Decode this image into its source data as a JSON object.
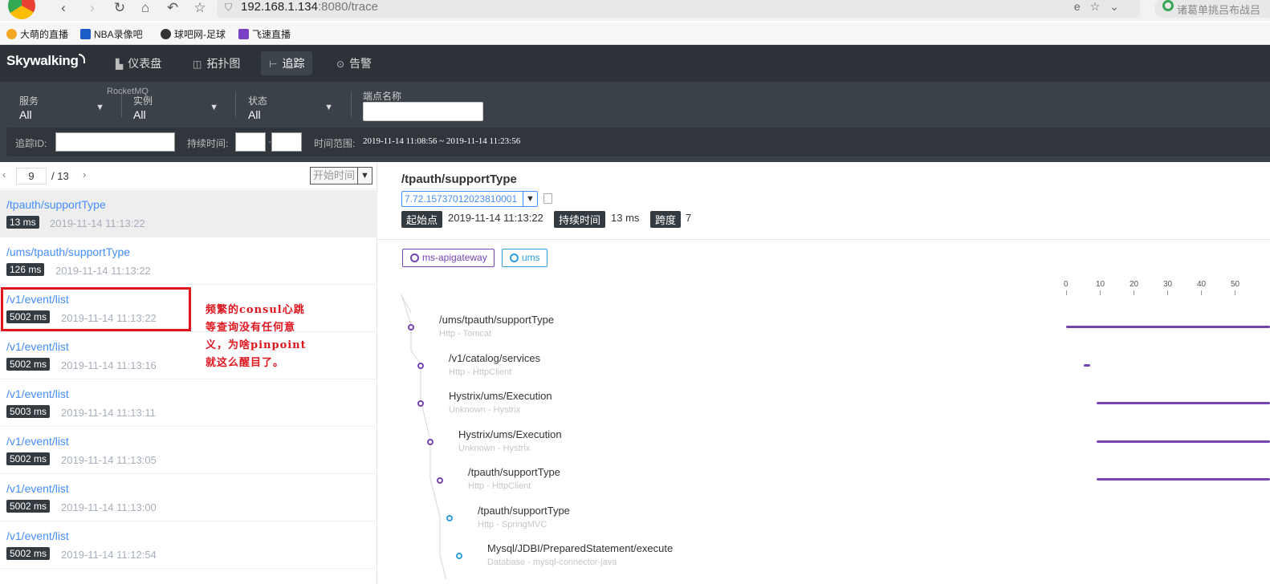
{
  "browser": {
    "url_host": "192.168.1.134",
    "url_rest": ":8080/trace",
    "search_text": "诸葛单挑吕布战吕",
    "bookmarks": [
      "大萌的直播",
      "NBA录像吧",
      "球吧网-足球",
      "飞速直播"
    ]
  },
  "app": {
    "logo": "Skywalking",
    "nav": [
      "仪表盘",
      "拓扑图",
      "追踪",
      "告警"
    ]
  },
  "filters": {
    "service_label": "服务",
    "service_value": "All",
    "instance_label": "实例",
    "instance_value": "All",
    "instance_overlay": "RocketMQ",
    "status_label": "状态",
    "status_value": "All",
    "endpoint_label": "端点名称",
    "trace_id_label": "追踪ID:",
    "duration_label": "持续时间:",
    "time_range_label": "时间范围:",
    "time_range_value": "2019-11-14 11:08:56 ~ 2019-11-14 11:23:56"
  },
  "list": {
    "page": "9",
    "total": "/ 13",
    "sort": "开始时间",
    "items": [
      {
        "endpoint": "/tpauth/supportType",
        "duration": "13 ms",
        "time": "2019-11-14 11:13:22"
      },
      {
        "endpoint": "/ums/tpauth/supportType",
        "duration": "126 ms",
        "time": "2019-11-14 11:13:22"
      },
      {
        "endpoint": "/v1/event/list",
        "duration": "5002 ms",
        "time": "2019-11-14 11:13:22"
      },
      {
        "endpoint": "/v1/event/list",
        "duration": "5002 ms",
        "time": "2019-11-14 11:13:16"
      },
      {
        "endpoint": "/v1/event/list",
        "duration": "5003 ms",
        "time": "2019-11-14 11:13:11"
      },
      {
        "endpoint": "/v1/event/list",
        "duration": "5002 ms",
        "time": "2019-11-14 11:13:05"
      },
      {
        "endpoint": "/v1/event/list",
        "duration": "5002 ms",
        "time": "2019-11-14 11:13:00"
      },
      {
        "endpoint": "/v1/event/list",
        "duration": "5002 ms",
        "time": "2019-11-14 11:12:54"
      }
    ],
    "annotation_lines": [
      "频繁的consul心跳",
      "等查询没有任何意",
      "义，为啥pinpoint",
      "就这么醒目了。"
    ]
  },
  "detail": {
    "title": "/tpauth/supportType",
    "trace_id": "7.72.15737012023810001",
    "start_label": "起始点",
    "start_value": "2019-11-14 11:13:22",
    "duration_label": "持续时间",
    "duration_value": "13 ms",
    "span_label": "跨度",
    "span_value": "7",
    "legend": [
      {
        "name": "ms-apigateway",
        "color": "#7444b3"
      },
      {
        "name": "ums",
        "color": "#2f9ed8"
      }
    ],
    "scale": [
      "0",
      "10",
      "20",
      "30",
      "40",
      "50"
    ],
    "spans": [
      {
        "name": "/ums/tpauth/supportType",
        "sub": "Http - Tomcat"
      },
      {
        "name": "/v1/catalog/services",
        "sub": "Http - HttpClient"
      },
      {
        "name": "Hystrix/ums/Execution",
        "sub": "Unknown - Hystrix"
      },
      {
        "name": "Hystrix/ums/Execution",
        "sub": "Unknown - Hystrix"
      },
      {
        "name": "/tpauth/supportType",
        "sub": "Http - HttpClient"
      },
      {
        "name": "/tpauth/supportType",
        "sub": "Http - SpringMVC"
      },
      {
        "name": "Mysql/JDBI/PreparedStatement/execute",
        "sub": "Database - mysql-connector-java"
      }
    ]
  }
}
